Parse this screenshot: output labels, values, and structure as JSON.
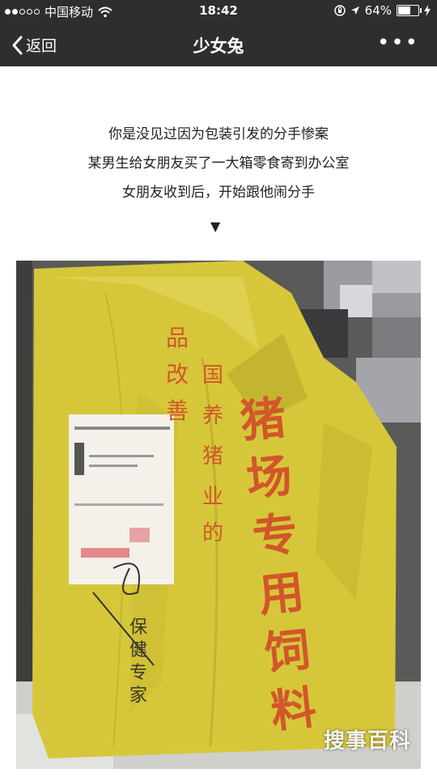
{
  "status_bar": {
    "carrier": "中国移动",
    "time": "18:42",
    "battery": "64%",
    "battery_level": 0.64
  },
  "nav": {
    "back_label": "返回",
    "title": "少女兔",
    "more_label": "•••"
  },
  "caption": {
    "lines": [
      "你是没见过因为包装引发的分手惨案",
      "某男生给女朋友买了一大箱零食寄到办公室",
      "女朋友收到后，开始跟他闹分手"
    ],
    "arrow": "▼"
  },
  "photo": {
    "bag_text_right": [
      "猪",
      "场",
      "专",
      "用",
      "饲",
      "料"
    ],
    "handwriting": [
      "保",
      "健",
      "专",
      "家"
    ],
    "watermark": "搜事百科"
  },
  "colors": {
    "bar_bg": "#2e2e30",
    "bag_yellow": "#d6c73a",
    "bag_text": "#d2562a"
  }
}
